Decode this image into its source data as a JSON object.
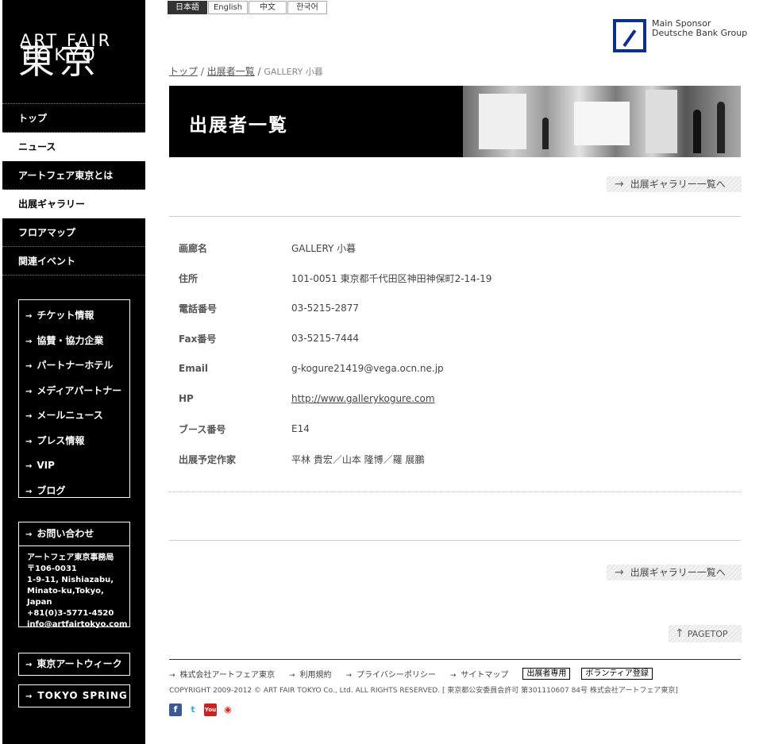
{
  "sidebar": {
    "logo": {
      "line1": "ART FAIR",
      "line2": "TOKYO",
      "kanji": "東京"
    },
    "nav": [
      {
        "label": "トップ",
        "active": false
      },
      {
        "label": "ニュース",
        "active": true
      },
      {
        "label": "アートフェア東京とは",
        "active": false
      },
      {
        "label": "出展ギャラリー",
        "active": true
      },
      {
        "label": "フロアマップ",
        "active": false
      },
      {
        "label": "関連イベント",
        "active": false
      }
    ],
    "links": [
      "チケット情報",
      "協賛・協力企業",
      "パートナーホテル",
      "メディアパートナー",
      "メールニュース",
      "プレス情報",
      "VIP",
      "ブログ"
    ],
    "contact": {
      "title": "お問い合わせ",
      "lines": [
        "アートフェア東京事務局",
        "〒106-0031",
        "1-9-11, Nishiazabu,",
        "Minato-ku,Tokyo, Japan",
        "+81(0)3-5771-4520",
        "info@artfairtokyo.com"
      ]
    },
    "external": [
      "東京アートウィーク",
      "TOKYO SPRING"
    ],
    "arrow": "→"
  },
  "langs": [
    {
      "label": "日本語",
      "active": true,
      "width": 50
    },
    {
      "label": "English",
      "active": false,
      "width": 50
    },
    {
      "label": "中文",
      "active": false,
      "width": 48
    },
    {
      "label": "한국어",
      "active": false,
      "width": 50
    }
  ],
  "sponsor": {
    "line1": "Main Sponsor",
    "line2": "Deutsche Bank Group",
    "color": "#0a2f8c"
  },
  "breadcrumb": {
    "top": "トップ",
    "list": "出展者一覧",
    "sep": " / ",
    "current": "GALLERY 小暮"
  },
  "banner": {
    "title": "出展者一覧"
  },
  "gallery_link": "出展ギャラリー一覧へ",
  "details": [
    {
      "label": "画廊名",
      "value": "GALLERY 小暮"
    },
    {
      "label": "住所",
      "value": "101-0051 東京都千代田区神田神保町2-14-19"
    },
    {
      "label": "電話番号",
      "value": "03-5215-2877"
    },
    {
      "label": "Fax番号",
      "value": "03-5215-7444"
    },
    {
      "label": "Email",
      "value": "g-kogure21419@vega.ocn.ne.jp"
    },
    {
      "label": "HP",
      "value": "http://www.gallerykogure.com",
      "link": true
    },
    {
      "label": "ブース番号",
      "value": "E14"
    },
    {
      "label": "出展予定作家",
      "value": "平林 貴宏／山本 隆博／羅 展鵬"
    }
  ],
  "pagetop": "PAGETOP",
  "footer": {
    "links": [
      "株式会社アートフェア東京",
      "利用規約",
      "プライバシーポリシー",
      "サイトマップ"
    ],
    "boxes": [
      "出展者専用",
      "ボランティア登録"
    ],
    "copyright": "COPYRIGHT 2009-2012 © ART FAIR TOKYO Co., Ltd. ALL RIGHTS RESERVED.   [ 東京都公安委員会許可 第301110607 84号 株式会社アートフェア東京]",
    "social": [
      {
        "icon": "facebook-icon",
        "glyph": "f"
      },
      {
        "icon": "twitter-icon",
        "glyph": "t"
      },
      {
        "icon": "youtube-icon",
        "glyph": "You"
      },
      {
        "icon": "weibo-icon",
        "glyph": "◉"
      }
    ]
  }
}
